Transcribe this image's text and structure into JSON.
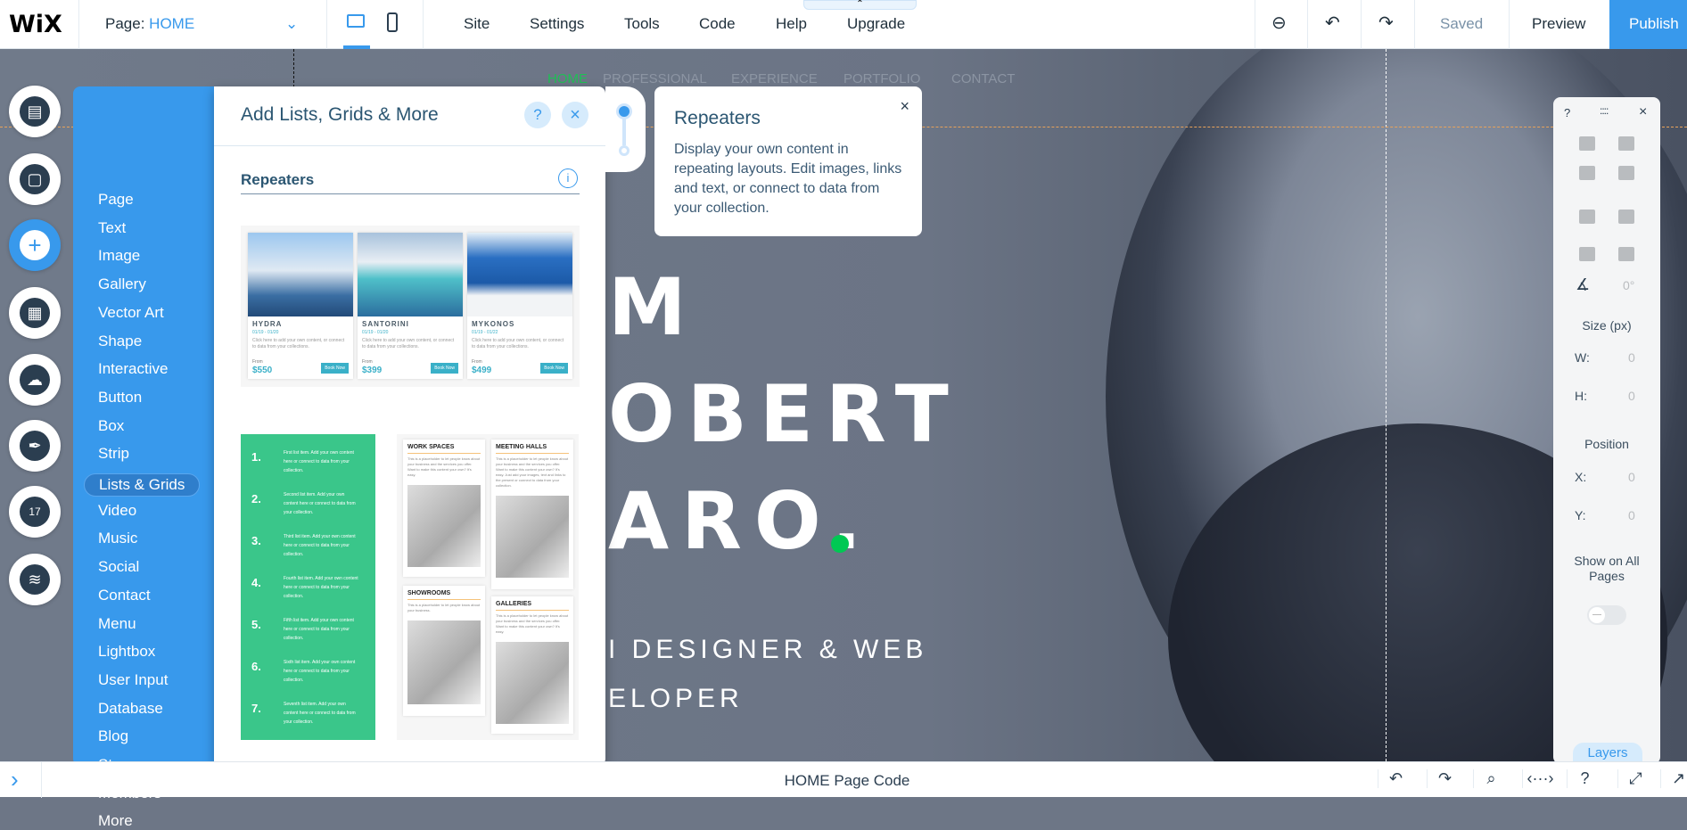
{
  "topbar": {
    "logo": "WiX",
    "page_label": "Page:",
    "page_value": "HOME",
    "menu": [
      "Site",
      "Settings",
      "Tools",
      "Code",
      "Help",
      "Upgrade"
    ],
    "saved": "Saved",
    "preview": "Preview",
    "publish": "Publish",
    "collapse_tab_icon": "chevron-up-icon"
  },
  "site": {
    "nav": [
      "HOME",
      "PROFESSIONAL",
      "EXPERIENCE",
      "PORTFOLIO",
      "CONTACT"
    ],
    "hero_lines": [
      "M",
      "OBERT",
      "ARO."
    ],
    "subtitle_lines": [
      "I DESIGNER & WEB",
      "ELOPER"
    ],
    "accent": "#00c853"
  },
  "rail": {
    "icons": [
      "pages-icon",
      "background-icon",
      "add-icon",
      "app-market-icon",
      "upload-icon",
      "blog-pen-icon",
      "bookings-calendar-icon",
      "database-icon"
    ],
    "calendar_day": "17"
  },
  "categories": {
    "items": [
      "Page",
      "Text",
      "Image",
      "Gallery",
      "Vector Art",
      "Shape",
      "Interactive",
      "Button",
      "Box",
      "Strip",
      "Lists & Grids",
      "Video",
      "Music",
      "Social",
      "Contact",
      "Menu",
      "Lightbox",
      "User Input",
      "Database",
      "Blog",
      "Store",
      "Members",
      "More"
    ],
    "selected": "Lists & Grids"
  },
  "panel": {
    "title": "Add Lists, Grids & More",
    "help": "?",
    "close": "×",
    "section": "Repeaters",
    "info": "i",
    "repeater": {
      "cards": [
        {
          "name": "HYDRA",
          "dates": "01/19 - 01/20",
          "desc": "Click here to add your own content, or connect to data from your collections.",
          "from": "From",
          "price": "$550",
          "button": "Book Now"
        },
        {
          "name": "SANTORINI",
          "dates": "01/19 - 01/20",
          "desc": "Click here to add your own content, or connect to data from your collections.",
          "from": "From",
          "price": "$399",
          "button": "Book Now"
        },
        {
          "name": "MYKONOS",
          "dates": "01/19 - 01/22",
          "desc": "Click here to add your own content, or connect to data from your collections.",
          "from": "From",
          "price": "$499",
          "button": "Book Now"
        }
      ]
    },
    "list": {
      "items": [
        {
          "n": "1.",
          "t": "First list item. Add your own content here or connect to data from your collection."
        },
        {
          "n": "2.",
          "t": "Second list item. Add your own content here or connect to data from your collection."
        },
        {
          "n": "3.",
          "t": "Third list item. Add your own content here or connect to data from your collection."
        },
        {
          "n": "4.",
          "t": "Fourth list item. Add your own content here or connect to data from your collection."
        },
        {
          "n": "5.",
          "t": "Fifth list item. Add your own content here or connect to data from your collection."
        },
        {
          "n": "6.",
          "t": "Sixth list item. Add your own content here or connect to data from your collection."
        },
        {
          "n": "7.",
          "t": "Seventh list item. Add your own content here or connect to data from your collection."
        }
      ]
    },
    "grid": {
      "cards": [
        {
          "h": "WORK SPACES",
          "t": "This is a placeholder to let people know about your business and the services you offer. Want to make this content your own? It's easy."
        },
        {
          "h": "MEETING HALLS",
          "t": "This is a placeholder to let people know about your business and the services you offer. Want to make this content your own? It's easy. Just add your images, text and links to the present or connect to data from your collection."
        },
        {
          "h": "SHOWROOMS",
          "t": "This is a placeholder to let people know about your business."
        },
        {
          "h": "GALLERIES",
          "t": "This is a placeholder to let people know about your business and the services you offer. Want to make this content your own? It's easy."
        }
      ]
    }
  },
  "tooltip": {
    "title": "Repeaters",
    "body": "Display your own content in repeating layouts. Edit images, links and text, or connect to data from your collection.",
    "close": "×"
  },
  "inspector": {
    "help": "?",
    "drag": "::::",
    "close": "×",
    "rotation": "0°",
    "size_label": "Size (px)",
    "w_label": "W:",
    "w": "0",
    "h_label": "H:",
    "h": "0",
    "position_label": "Position",
    "x_label": "X:",
    "x": "0",
    "y_label": "Y:",
    "y": "0",
    "show_all": "Show on All Pages",
    "show_all_on": false,
    "layers": "Layers"
  },
  "bottombar": {
    "title": "HOME Page Code",
    "expand": "›",
    "icons": [
      "undo-icon",
      "redo-icon",
      "search-icon",
      "code-properties-icon",
      "help-icon",
      "maximize-icon",
      "external-icon"
    ],
    "glyphs": [
      "↶",
      "↷",
      "⌕",
      "‹···›",
      "?",
      "⤢",
      "↗"
    ]
  },
  "colors": {
    "brand": "#3899ec",
    "text": "#20303c",
    "green_list": "#3ac68a"
  }
}
